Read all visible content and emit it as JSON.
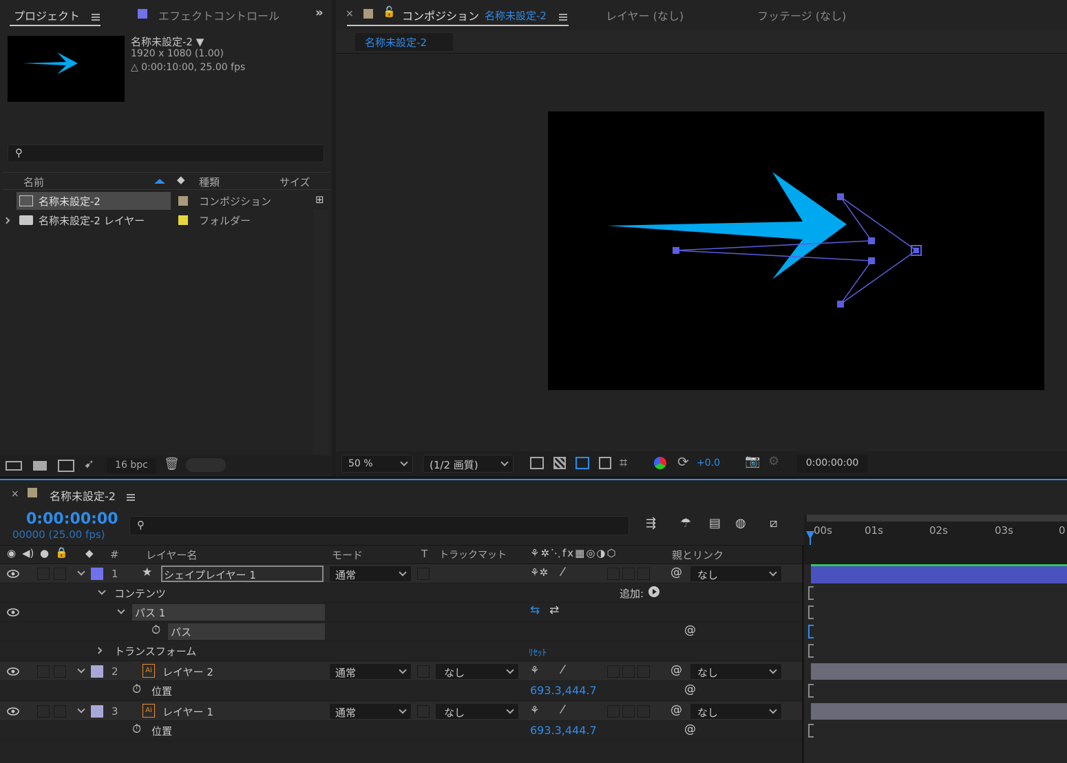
{
  "project": {
    "tab_project": "プロジェクト",
    "tab_effects": "エフェクトコントロール",
    "comp_name": "名称未設定-2 ▼",
    "comp_size": "1920 x 1080 (1.00)",
    "comp_duration": "△ 0:00:10:00, 25.00 fps",
    "col_name": "名前",
    "col_type": "種類",
    "col_size": "サイズ",
    "items": [
      {
        "name": "名称未設定-2",
        "type": "コンポジション",
        "color": "#a89a7a"
      },
      {
        "name": "名称未設定-2 レイヤー",
        "type": "フォルダー",
        "color": "#e6d83c"
      }
    ],
    "bpc": "16 bpc"
  },
  "composition": {
    "tab_label": "コンポジション",
    "tab_comp_name": "名称未設定-2",
    "tab_layer": "レイヤー (なし)",
    "tab_footage": "フッテージ (なし)",
    "sub_tab": "名称未設定-2",
    "zoom": "50 %",
    "quality": "(1/2 画質)",
    "exposure": "+0.0",
    "timecode": "0:00:00:00",
    "arrow_color": "#00a8f0",
    "path_color": "#5b5ee0"
  },
  "timeline": {
    "tab_name": "名称未設定-2",
    "timecode": "0:00:00:00",
    "frames": "00000 (25.00 fps)",
    "col_num": "#",
    "col_layer_name": "レイヤー名",
    "col_mode": "モード",
    "col_t": "T",
    "col_trackmatte": "トラックマット",
    "col_parent": "親とリンク",
    "ruler": [
      "00s",
      "01s",
      "02s",
      "03s",
      "0"
    ],
    "layer1": {
      "num": "1",
      "name": "シェイプレイヤー 1",
      "mode": "通常",
      "parent": "なし",
      "color": "#6f72e8"
    },
    "contents": "コンテンツ",
    "add_label": "追加:",
    "path1": "パス 1",
    "path": "パス",
    "transform": "トランスフォーム",
    "reset": "ﾘｾｯﾄ",
    "layer2": {
      "num": "2",
      "name": "レイヤー 2",
      "mode": "通常",
      "matte": "なし",
      "parent": "なし",
      "color": "#a8a8d8"
    },
    "pos_label": "位置",
    "pos_value": "693.3,444.7",
    "layer3": {
      "num": "3",
      "name": "レイヤー 1",
      "mode": "通常",
      "matte": "なし",
      "parent": "なし",
      "color": "#a8a8d8"
    },
    "ai_badge": "Ai"
  }
}
